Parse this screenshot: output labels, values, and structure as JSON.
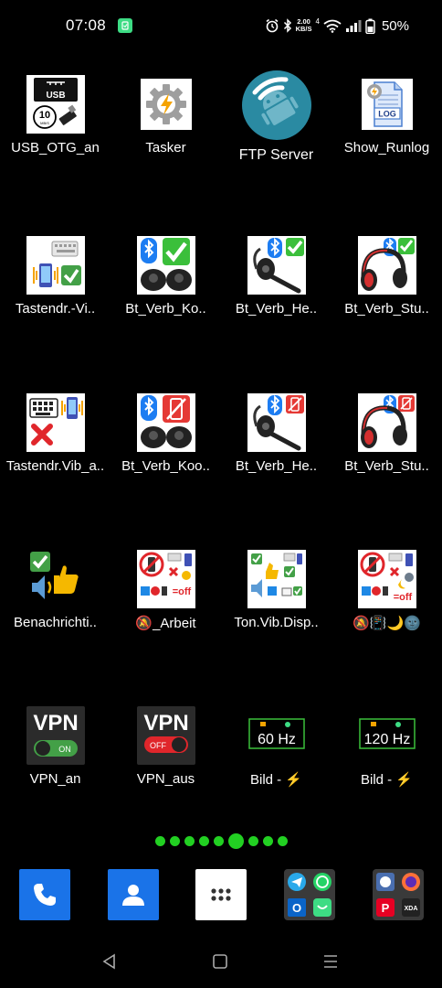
{
  "status_bar": {
    "time": "07:08",
    "net_speed_value": "2.00",
    "net_speed_unit": "KB/S",
    "network_type": "4",
    "battery_percent": "50%"
  },
  "apps": [
    {
      "label": "USB_OTG_an",
      "icon": "usb-otg-icon"
    },
    {
      "label": "Tasker",
      "icon": "tasker-icon"
    },
    {
      "label": "FTP Server",
      "icon": "ftp-server-icon"
    },
    {
      "label": "Show_Runlog",
      "icon": "log-file-icon"
    },
    {
      "label": "Tastendr.-Vi..",
      "icon": "keyboard-vibrate-on-icon"
    },
    {
      "label": "Bt_Verb_Ko..",
      "icon": "bt-earbuds-connect-icon"
    },
    {
      "label": "Bt_Verb_He..",
      "icon": "bt-headset-connect-icon"
    },
    {
      "label": "Bt_Verb_Stu..",
      "icon": "bt-headphones-connect-icon"
    },
    {
      "label": "Tastendr.Vib_a..",
      "icon": "keyboard-vibrate-off-icon"
    },
    {
      "label": "Bt_Verb_Koo..",
      "icon": "bt-earbuds-disconnect-icon"
    },
    {
      "label": "Bt_Verb_He..",
      "icon": "bt-headset-disconnect-icon"
    },
    {
      "label": "Bt_Verb_Stu..",
      "icon": "bt-headphones-disconnect-icon"
    },
    {
      "label": "Benachrichti..",
      "icon": "notification-sound-icon"
    },
    {
      "label": "🔕_Arbeit",
      "icon": "work-mode-icon"
    },
    {
      "label": "Ton.Vib.Disp..",
      "icon": "sound-vibration-display-icon"
    },
    {
      "label": "🔕📳🌙🌚",
      "icon": "night-mode-icon"
    },
    {
      "label": "VPN_an",
      "icon": "vpn-on-icon",
      "icon_text": "VPN",
      "switch_text": "ON"
    },
    {
      "label": "VPN_aus",
      "icon": "vpn-off-icon",
      "icon_text": "VPN",
      "switch_text": "OFF"
    },
    {
      "label": "Bild - ⚡",
      "icon": "refresh-rate-60-icon",
      "icon_text": "60 Hz"
    },
    {
      "label": "Bild - ⚡",
      "icon": "refresh-rate-120-icon",
      "icon_text": "120 Hz"
    }
  ],
  "page_indicator": {
    "count": 9,
    "active_index": 5
  },
  "dock": [
    {
      "icon": "phone-icon"
    },
    {
      "icon": "contacts-icon"
    },
    {
      "icon": "app-drawer-icon"
    },
    {
      "icon": "messaging-folder-icon"
    },
    {
      "icon": "apps-folder-icon",
      "tile_text": "XDA"
    }
  ],
  "usb_icon": {
    "usb_text": "USB",
    "mbs_text": "10",
    "mbs_unit": "MB/S"
  },
  "log_icon": {
    "text": "LOG"
  },
  "work_icon": {
    "off_text": "=off"
  },
  "night_icon": {
    "off_text": "=off"
  },
  "colors": {
    "background": "#000000",
    "dot": "#22d022",
    "dock_blue": "#1a73e8",
    "check_green": "#3bbf3b",
    "bt_blue": "#1d7df2",
    "cross_red": "#e0262b"
  }
}
